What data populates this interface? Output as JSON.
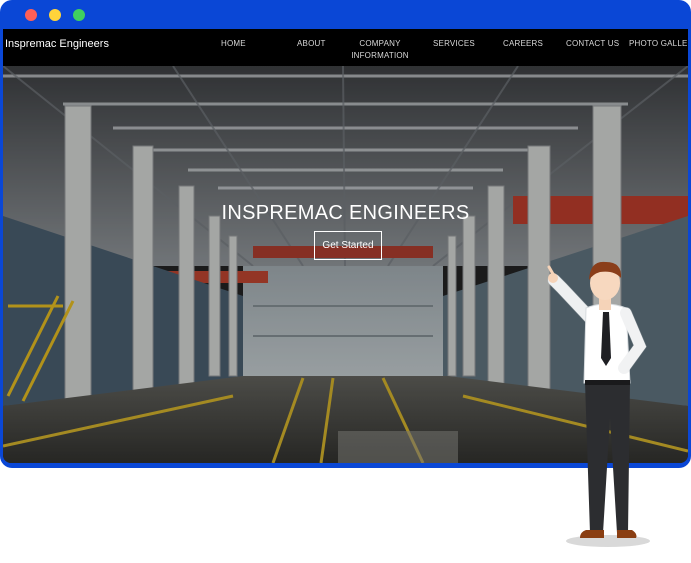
{
  "browser": {
    "frame_color": "#0a47d6",
    "controls": [
      "close-dot",
      "minimize-dot",
      "maximize-dot"
    ]
  },
  "navbar": {
    "brand": "Inspremac Engineers",
    "items": [
      {
        "label": "HOME"
      },
      {
        "label": "ABOUT"
      },
      {
        "label": "COMPANY\nINFORMATION"
      },
      {
        "label": "SERVICES"
      },
      {
        "label": "CAREERS"
      },
      {
        "label": "CONTACT US"
      },
      {
        "label": "PHOTO GALLERY"
      }
    ]
  },
  "hero": {
    "title": "INSPREMAC ENGINEERS",
    "cta_label": "Get Started"
  }
}
